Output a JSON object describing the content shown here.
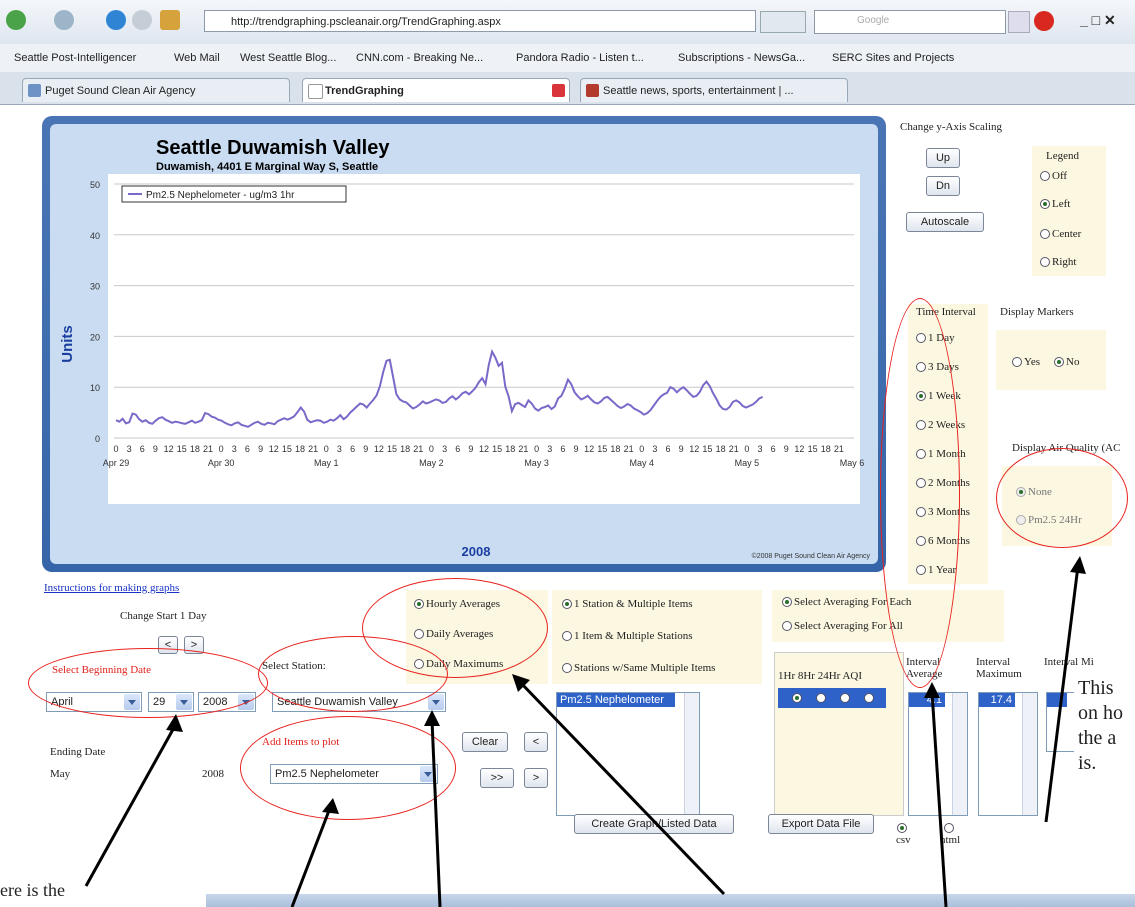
{
  "browser": {
    "url": "http://trendgraphing.pscleanair.org/TrendGraphing.aspx",
    "search_placeholder": "Google",
    "bookmarks": [
      "Seattle Post-Intelligencer",
      "Web Mail",
      "West Seattle Blog...",
      "CNN.com - Breaking Ne...",
      "Pandora Radio - Listen t...",
      "Subscriptions - NewsGa...",
      "SERC Sites and Projects"
    ],
    "tabs": [
      {
        "label": "Puget Sound Clean Air Agency",
        "active": false
      },
      {
        "label": "TrendGraphing",
        "active": true
      },
      {
        "label": "Seattle news, sports, entertainment | ...",
        "active": false
      }
    ]
  },
  "chart_data": {
    "type": "line",
    "title": "Seattle Duwamish Valley",
    "subtitle": "Duwamish, 4401 E Marginal Way S, Seattle",
    "ylabel": "Units",
    "xlabel": "2008",
    "ylim": [
      0,
      50
    ],
    "yticks": [
      0,
      10,
      20,
      30,
      40,
      50
    ],
    "xticks": [
      "Apr 29",
      "Apr 30",
      "May 1",
      "May 2",
      "May 3",
      "May 4",
      "May 5",
      "May 6"
    ],
    "hour_ticks": [
      "0",
      "3",
      "6",
      "9",
      "12",
      "15",
      "18",
      "21"
    ],
    "legend": "left",
    "grid": true,
    "series": [
      {
        "name": "Pm2.5 Nephelometer - ug/m3 1hr",
        "values": [
          3.5,
          3.2,
          3.8,
          2.9,
          3.1,
          4.8,
          4.6,
          3.7,
          3.2,
          3.5,
          3.0,
          2.8,
          3.4,
          3.9,
          4.1,
          3.6,
          3.3,
          3.0,
          3.2,
          3.1,
          2.9,
          2.8,
          3.1,
          3.4,
          3.0,
          3.2,
          3.5,
          4.9,
          4.7,
          4.2,
          4.0,
          3.6,
          3.4,
          3.0,
          2.7,
          2.5,
          2.9,
          3.1,
          2.6,
          2.4,
          2.2,
          2.6,
          3.0,
          3.2,
          2.8,
          2.6,
          3.0,
          2.9,
          2.7,
          3.3,
          3.6,
          3.9,
          3.6,
          3.9,
          4.3,
          5.1,
          6.0,
          5.2,
          3.6,
          3.1,
          3.3,
          3.5,
          3.4,
          3.0,
          3.2,
          3.6,
          3.4,
          3.9,
          4.5,
          3.7,
          4.2,
          5.0,
          5.6,
          6.2,
          6.8,
          6.6,
          6.0,
          6.8,
          7.5,
          8.4,
          10.2,
          13.0,
          15.2,
          15.4,
          12.0,
          8.6,
          7.6,
          7.2,
          7.0,
          6.4,
          5.8,
          6.1,
          6.6,
          7.2,
          6.8,
          7.0,
          7.3,
          7.6,
          7.4,
          6.9,
          7.1,
          7.8,
          8.2,
          7.6,
          8.1,
          8.8,
          9.1,
          8.6,
          9.2,
          9.9,
          11.0,
          11.8,
          10.6,
          14.4,
          17.0,
          15.8,
          14.2,
          14.8,
          10.1,
          8.2,
          5.3,
          6.7,
          6.9,
          6.5,
          6.1,
          7.4,
          6.8,
          5.8,
          5.4,
          5.9,
          6.1,
          6.4,
          5.7,
          6.2,
          7.8,
          8.3,
          9.7,
          11.5,
          10.6,
          9.0,
          8.2,
          7.6,
          7.9,
          8.3,
          7.6,
          7.0,
          6.8,
          7.2,
          7.9,
          8.1,
          7.5,
          6.9,
          6.3,
          5.9,
          6.2,
          6.7,
          6.4,
          5.8,
          5.5,
          5.1,
          4.6,
          4.9,
          5.5,
          6.4,
          7.3,
          8.1,
          8.6,
          8.9,
          10.0,
          9.7,
          9.0,
          9.6,
          10.0,
          9.4,
          8.7,
          8.1,
          8.3,
          9.1,
          10.4,
          11.1,
          10.2,
          8.8,
          7.7,
          6.4,
          5.7,
          5.6,
          6.1,
          7.1,
          7.4,
          7.0,
          6.3,
          6.0,
          6.3,
          6.6,
          7.1,
          7.8,
          8.1
        ]
      }
    ],
    "copyright": "©2008 Puget Sound Clean Air Agency"
  },
  "controls": {
    "y_axis_scaling_label": "Change y-Axis Scaling",
    "up_label": "Up",
    "dn_label": "Dn",
    "autoscale_label": "Autoscale",
    "legend_label": "Legend",
    "legend_options": [
      {
        "label": "Off",
        "on": false
      },
      {
        "label": "Left",
        "on": true
      },
      {
        "label": "Center",
        "on": false
      },
      {
        "label": "Right",
        "on": false
      }
    ],
    "time_interval_label": "Time Interval",
    "time_interval_options": [
      {
        "label": "1 Day",
        "on": false
      },
      {
        "label": "3 Days",
        "on": false
      },
      {
        "label": "1 Week",
        "on": true
      },
      {
        "label": "2 Weeks",
        "on": false
      },
      {
        "label": "1 Month",
        "on": false
      },
      {
        "label": "2 Months",
        "on": false
      },
      {
        "label": "3 Months",
        "on": false
      },
      {
        "label": "6 Months",
        "on": false
      },
      {
        "label": "1 Year",
        "on": false
      }
    ],
    "display_markers_label": "Display Markers",
    "markers_options": [
      {
        "label": "Yes",
        "on": false
      },
      {
        "label": "No",
        "on": true
      }
    ],
    "air_quality_label": "Display Air Quality (AC",
    "air_quality_options": [
      {
        "label": "None",
        "on": true
      },
      {
        "label": "Pm2.5 24Hr",
        "on": false
      }
    ],
    "instructions_link": "Instructions for making graphs",
    "change_start_label": "Change Start 1 Day",
    "select_beginning_date_label": "Select Beginning Date",
    "begin_month": "April",
    "begin_day": "29",
    "begin_year": "2008",
    "ending_date_label": "Ending Date",
    "end_month": "May",
    "end_year": "2008",
    "select_station_label": "Select Station:",
    "station_value": "Seattle Duwamish Valley",
    "add_items_label": "Add Items to plot",
    "item_value": "Pm2.5 Nephelometer",
    "clear_label": "Clear",
    "averaging_options": [
      {
        "label": "Hourly Averages",
        "on": true
      },
      {
        "label": "Daily Averages",
        "on": false
      },
      {
        "label": "Daily Maximums",
        "on": false
      }
    ],
    "station_mode_options": [
      {
        "label": "1 Station & Multiple Items",
        "on": true
      },
      {
        "label": "1 Item & Multiple Stations",
        "on": false
      },
      {
        "label": "Stations w/Same Multiple Items",
        "on": false
      }
    ],
    "select_averaging_options": [
      {
        "label": "Select Averaging For Each",
        "on": true
      },
      {
        "label": "Select Averaging For All",
        "on": false
      }
    ],
    "listed_item": "Pm2.5 Nephelometer",
    "aqi_header": "1Hr 8Hr 24Hr AQI",
    "interval_average_label": "Interval Average",
    "interval_average_value": "4.1",
    "interval_maximum_label": "Interval Maximum",
    "interval_maximum_value": "17.4",
    "interval_min_label": "Interval Mi",
    "create_graph_label": "Create Graph/Listed Data",
    "export_label": "Export Data File",
    "format_options": [
      {
        "label": "csv",
        "on": true
      },
      {
        "label": "html",
        "on": false
      }
    ]
  },
  "annotations": {
    "note_right": [
      "This",
      "on ho",
      "the a",
      "is."
    ],
    "note_bottom_left": "ere is the"
  }
}
